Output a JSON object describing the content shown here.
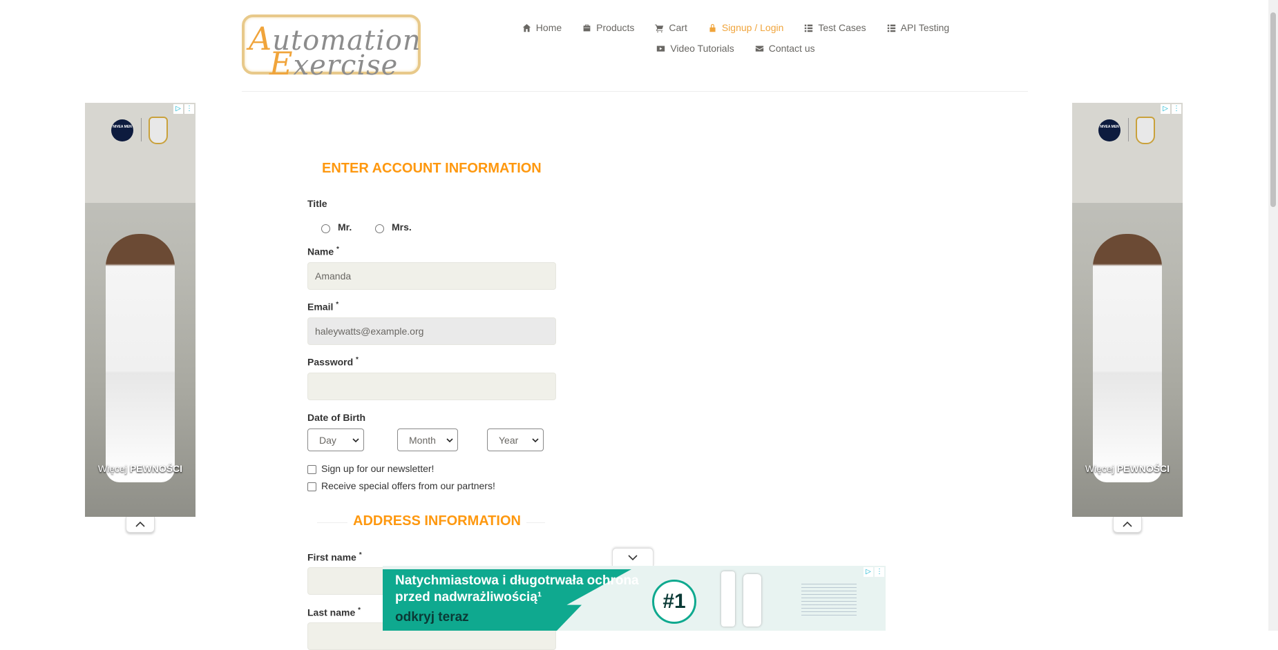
{
  "logo": {
    "line1_cap": "A",
    "line1_rest": "utomation",
    "line2_cap": "E",
    "line2_rest": "xercise"
  },
  "nav": {
    "items": [
      {
        "label": "Home",
        "icon": "home-icon"
      },
      {
        "label": "Products",
        "icon": "products-icon"
      },
      {
        "label": "Cart",
        "icon": "cart-icon"
      },
      {
        "label": "Signup / Login",
        "icon": "lock-icon",
        "active": true
      },
      {
        "label": "Test Cases",
        "icon": "list-icon"
      },
      {
        "label": "API Testing",
        "icon": "list-icon"
      },
      {
        "label": "Video Tutorials",
        "icon": "youtube-icon"
      },
      {
        "label": "Contact us",
        "icon": "envelope-icon"
      }
    ]
  },
  "side_ad": {
    "tagline_light": "Więcej ",
    "tagline_bold": "PEWNOŚCI",
    "brand": "NIVEA MEN"
  },
  "form": {
    "account_title": "ENTER ACCOUNT INFORMATION",
    "title_label": "Title",
    "title_options": [
      "Mr.",
      "Mrs."
    ],
    "name_label": "Name",
    "name_value": "Amanda",
    "email_label": "Email",
    "email_value": "haleywatts@example.org",
    "password_label": "Password",
    "password_value": "",
    "required_mark": "*",
    "dob_label": "Date of Birth",
    "day_value": "Day",
    "month_value": "Month",
    "year_value": "Year",
    "newsletter_label": "Sign up for our newsletter!",
    "offers_label": "Receive special offers from our partners!",
    "address_title": "ADDRESS INFORMATION",
    "first_name_label": "First name",
    "last_name_label": "Last name"
  },
  "bottom_ad": {
    "headline": "Natychmiastowa i długotrwała ochrona przed nadwrażliwością¹",
    "cta": "odkryj teraz",
    "badge": "#1"
  },
  "colors": {
    "accent": "#fe980f",
    "nav_active": "#f0a43b",
    "input_bg": "#f0f0e9",
    "ad_green": "#0fa98f"
  }
}
